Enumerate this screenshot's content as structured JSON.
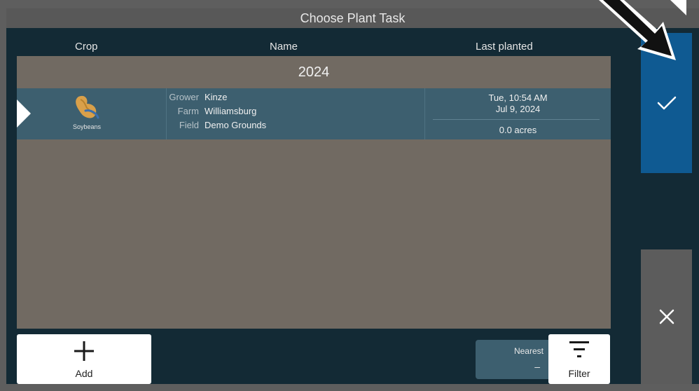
{
  "dialog": {
    "title": "Choose Plant Task"
  },
  "columns": {
    "crop": "Crop",
    "name": "Name",
    "last_planted": "Last planted"
  },
  "list": {
    "year": "2024",
    "tasks": [
      {
        "crop_name": "Soybeans",
        "crop_icon": "soybean-icon",
        "grower_label": "Grower",
        "grower": "Kinze",
        "farm_label": "Farm",
        "farm": "Williamsburg",
        "field_label": "Field",
        "field": "Demo Grounds",
        "time": "Tue, 10:54 AM",
        "date": "Jul 9, 2024",
        "acres": "0.0 acres"
      }
    ]
  },
  "actions": {
    "confirm_icon": "check-icon",
    "cancel_icon": "close-icon",
    "add_label": "Add",
    "filter_label": "Filter",
    "sort_label": "Nearest",
    "sort_value": "–"
  },
  "colors": {
    "background": "#132a35",
    "panel": "#716a62",
    "selected_row": "#3d5f6f",
    "confirm": "#0f5a92",
    "cancel": "#5c5c5c"
  }
}
